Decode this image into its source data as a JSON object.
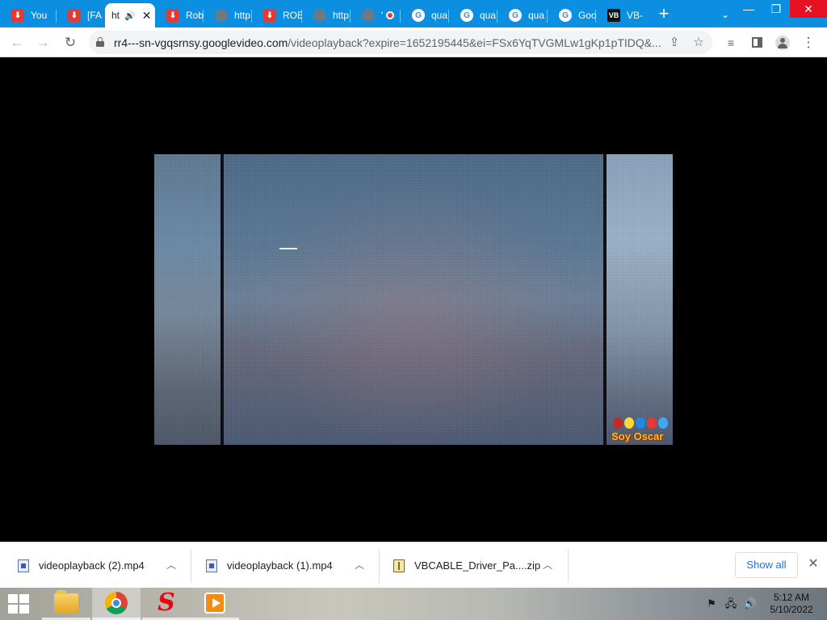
{
  "browser": {
    "tabs": [
      {
        "title": "You",
        "favicon": "red-download",
        "active": false
      },
      {
        "title": "[FA",
        "favicon": "red-download",
        "active": false
      },
      {
        "title": "ht",
        "favicon": "none",
        "active": true
      },
      {
        "title": "Rob",
        "favicon": "red-download",
        "active": false
      },
      {
        "title": "http",
        "favicon": "globe",
        "active": false
      },
      {
        "title": "ROE",
        "favicon": "red-download",
        "active": false
      },
      {
        "title": "http",
        "favicon": "globe",
        "active": false
      },
      {
        "title": "'",
        "favicon": "globe",
        "active": false
      },
      {
        "title": "qua",
        "favicon": "google",
        "active": false
      },
      {
        "title": "qua",
        "favicon": "google",
        "active": false
      },
      {
        "title": "qua",
        "favicon": "google",
        "active": false
      },
      {
        "title": "Goo",
        "favicon": "google",
        "active": false
      },
      {
        "title": "VB-",
        "favicon": "vb",
        "active": false
      }
    ],
    "new_tab_label": "+",
    "address": {
      "host": "rr4---sn-vgqsrnsy.googlevideo.com",
      "path": "/videoplayback?expire=1652195445&ei=FSx6YqTVGMLw1gKp1pTIDQ&..."
    },
    "accent_color": "#0c8fe0"
  },
  "video": {
    "watermark": "Soy Oscar"
  },
  "downloads": {
    "items": [
      {
        "filename": "videoplayback (2).mp4",
        "type": "video"
      },
      {
        "filename": "videoplayback (1).mp4",
        "type": "video"
      },
      {
        "filename": "VBCABLE_Driver_Pa....zip",
        "type": "zip"
      }
    ],
    "show_all_label": "Show all"
  },
  "taskbar": {
    "apps": [
      "file-explorer",
      "chrome",
      "s-app",
      "media-player"
    ],
    "clock": {
      "time": "5:12 AM",
      "date": "5/10/2022"
    }
  }
}
